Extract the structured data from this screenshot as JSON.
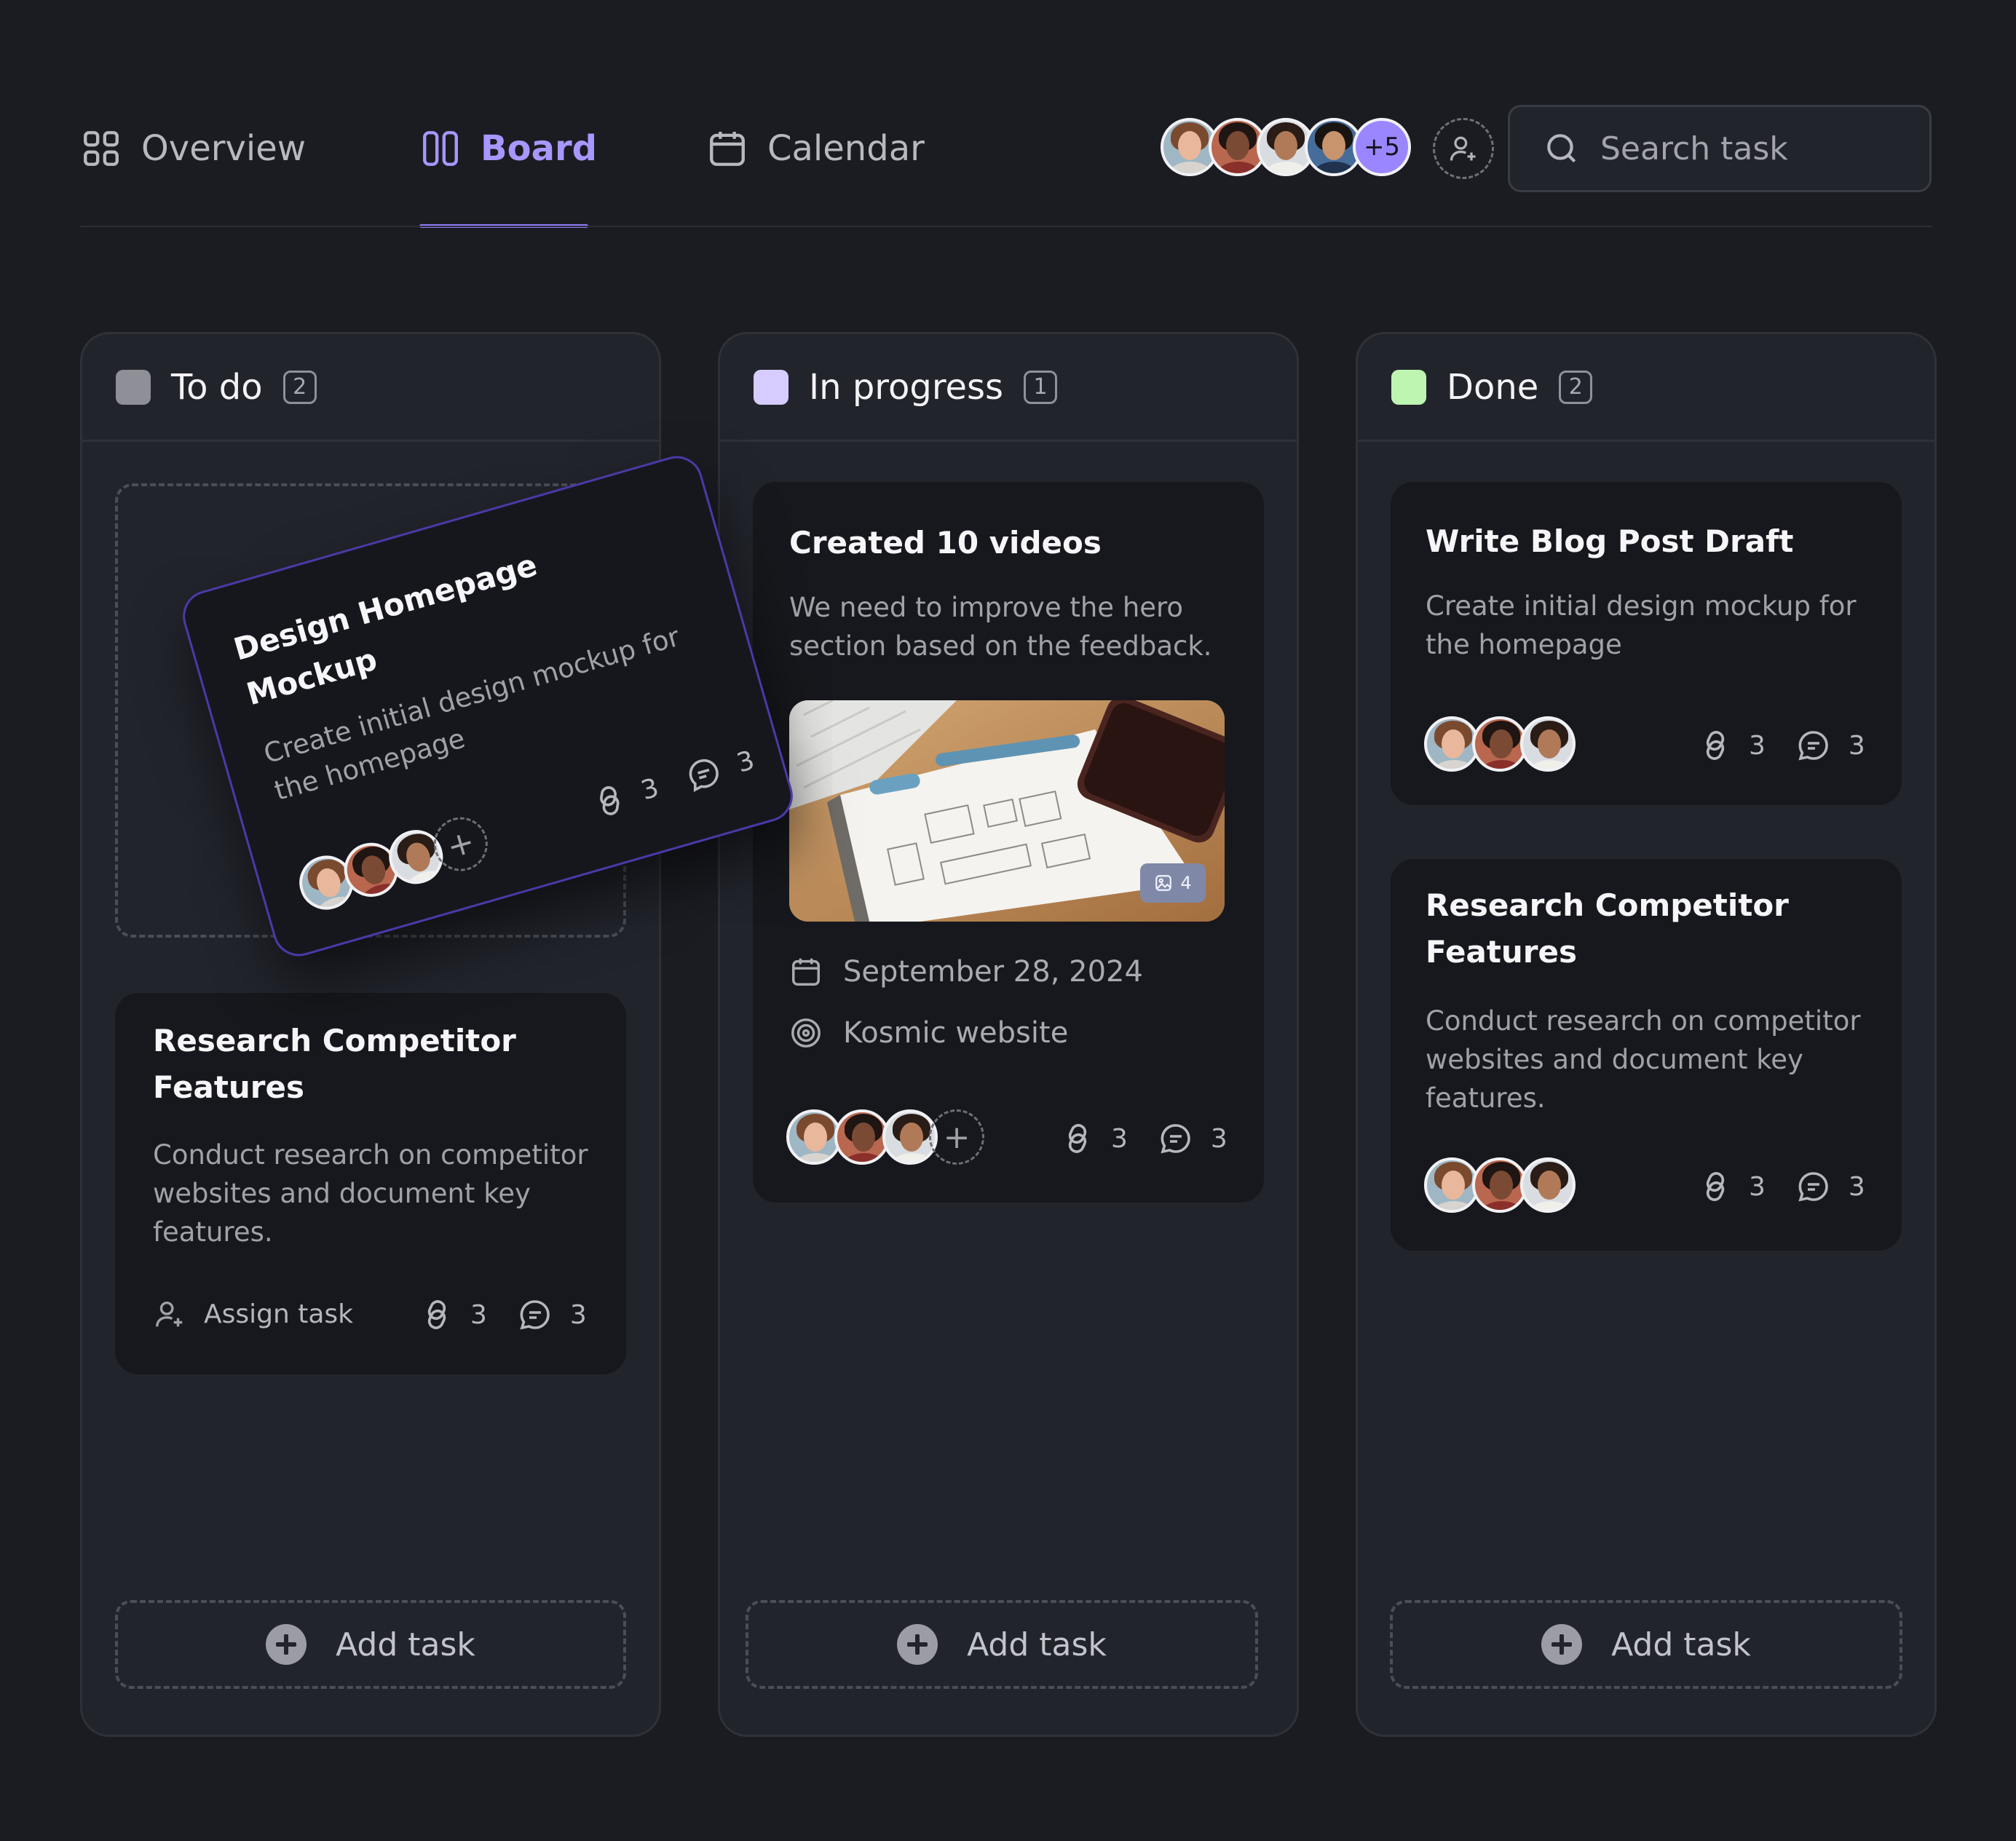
{
  "nav": {
    "tabs": [
      {
        "label": "Overview",
        "icon": "grid-icon"
      },
      {
        "label": "Board",
        "icon": "board-columns-icon",
        "active": true
      },
      {
        "label": "Calendar",
        "icon": "calendar-icon"
      }
    ],
    "more_members": "+5",
    "search_placeholder": "Search task"
  },
  "colors": {
    "background": "#1b1c22",
    "accent": "#8f7bf7",
    "todo": "#8f9097",
    "in_progress": "#d6ccff",
    "done": "#bdf5b1"
  },
  "columns": [
    {
      "title": "To do",
      "count": "2",
      "dragging_card": {
        "title": "Design Homepage Mockup",
        "description": "Create initial design mockup for the homepage",
        "links": "3",
        "comments": "3"
      },
      "cards": [
        {
          "title": "Research Competitor Features",
          "description": "Conduct research on competitor websites and document key features.",
          "assign_label": "Assign task",
          "links": "3",
          "comments": "3"
        }
      ],
      "add_label": "Add task"
    },
    {
      "title": "In progress",
      "count": "1",
      "cards": [
        {
          "title": "Created 10 videos",
          "description": "We need to improve the hero section based on the feedback.",
          "image_count": "4",
          "date": "September 28, 2024",
          "project": "Kosmic website",
          "links": "3",
          "comments": "3"
        }
      ],
      "add_label": "Add task"
    },
    {
      "title": "Done",
      "count": "2",
      "cards": [
        {
          "title": "Write Blog Post Draft",
          "description": "Create initial design mockup for the homepage",
          "links": "3",
          "comments": "3"
        },
        {
          "title": "Research Competitor Features",
          "description": "Conduct research on competitor websites and document key features.",
          "links": "3",
          "comments": "3"
        }
      ],
      "add_label": "Add task"
    }
  ]
}
